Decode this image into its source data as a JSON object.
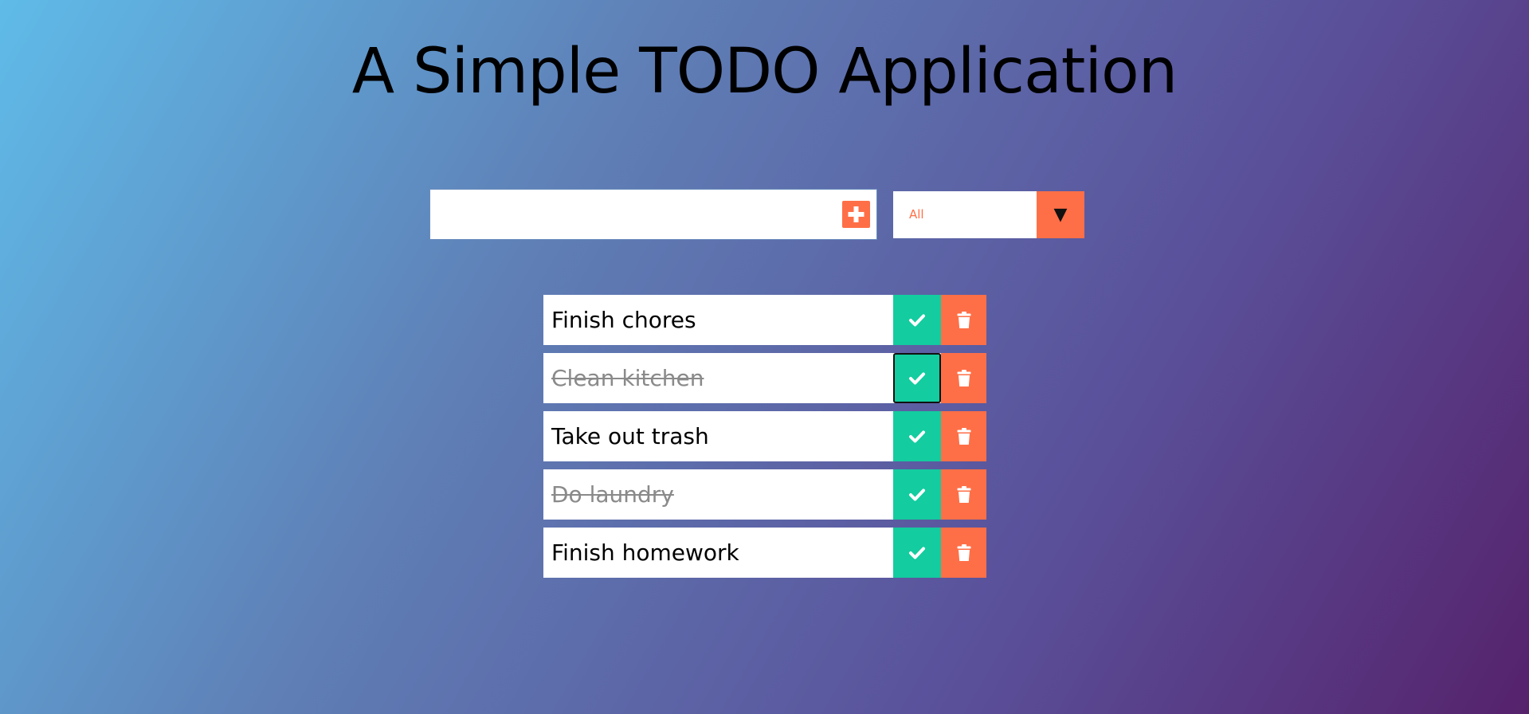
{
  "app": {
    "title": "A Simple TODO Application"
  },
  "add_form": {
    "input_value": "",
    "input_placeholder": "",
    "add_icon": "plus-square-icon"
  },
  "filter": {
    "selected": "All",
    "arrow_icon": "triangle-down-icon"
  },
  "todos": [
    {
      "text": "Finish chores",
      "completed": false
    },
    {
      "text": "Clean kitchen",
      "completed": true
    },
    {
      "text": "Take out trash",
      "completed": false
    },
    {
      "text": "Do laundry",
      "completed": true
    },
    {
      "text": "Finish homework",
      "completed": false
    }
  ],
  "icons": {
    "complete": "check-icon",
    "delete": "trash-icon"
  },
  "colors": {
    "accent_orange": "#ff6f47",
    "complete_green": "#13cc9f",
    "gradient_start": "#5fbbe8",
    "gradient_end": "#56226c"
  }
}
